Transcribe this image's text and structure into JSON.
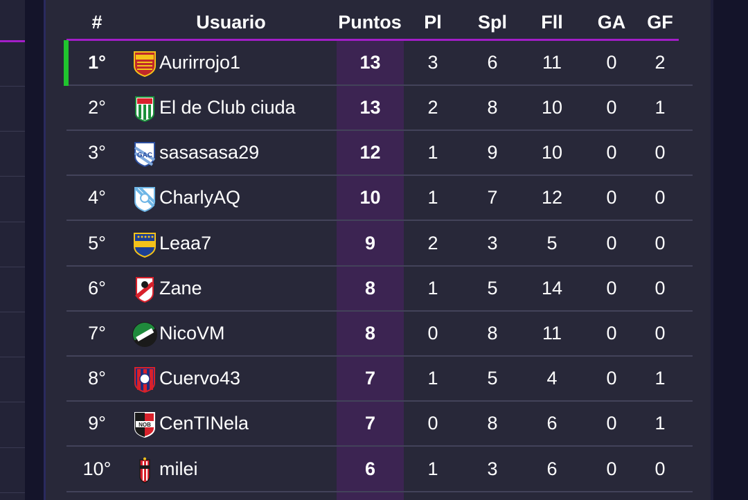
{
  "headers": {
    "pos": "#",
    "user": "Usuario",
    "points": "Puntos",
    "pl": "Pl",
    "spl": "Spl",
    "fll": "Fll",
    "ga": "GA",
    "gf": "GF"
  },
  "colors": {
    "accent": "#a31ec8",
    "leader": "#20c42e",
    "points_column": "#3c2452"
  },
  "rows": [
    {
      "pos": "1°",
      "user": "Aurirrojo1",
      "points": "13",
      "pl": "3",
      "spl": "6",
      "fll": "11",
      "ga": "0",
      "gf": "2",
      "crest": "boca-unidos-crest"
    },
    {
      "pos": "2°",
      "user": "El de Club ciuda",
      "points": "13",
      "pl": "2",
      "spl": "8",
      "fll": "10",
      "ga": "0",
      "gf": "1",
      "crest": "caa-crest"
    },
    {
      "pos": "3°",
      "user": "sasasasa29",
      "points": "12",
      "pl": "1",
      "spl": "9",
      "fll": "10",
      "ga": "0",
      "gf": "0",
      "crest": "gac-crest"
    },
    {
      "pos": "4°",
      "user": "CharlyAQ",
      "points": "10",
      "pl": "1",
      "spl": "7",
      "fll": "12",
      "ga": "0",
      "gf": "0",
      "crest": "ao-crest"
    },
    {
      "pos": "5°",
      "user": "Leaa7",
      "points": "9",
      "pl": "2",
      "spl": "3",
      "fll": "5",
      "ga": "0",
      "gf": "0",
      "crest": "cabj-crest"
    },
    {
      "pos": "6°",
      "user": "Zane",
      "points": "8",
      "pl": "1",
      "spl": "5",
      "fll": "14",
      "ga": "0",
      "gf": "0",
      "crest": "river-crest"
    },
    {
      "pos": "7°",
      "user": "NicoVM",
      "points": "8",
      "pl": "0",
      "spl": "8",
      "fll": "11",
      "ga": "0",
      "gf": "0",
      "crest": "cvm-crest"
    },
    {
      "pos": "8°",
      "user": "Cuervo43",
      "points": "7",
      "pl": "1",
      "spl": "5",
      "fll": "4",
      "ga": "0",
      "gf": "1",
      "crest": "casla-crest"
    },
    {
      "pos": "9°",
      "user": "CenTINela",
      "points": "7",
      "pl": "0",
      "spl": "8",
      "fll": "6",
      "ga": "0",
      "gf": "1",
      "crest": "nob-crest"
    },
    {
      "pos": "10°",
      "user": "milei",
      "points": "6",
      "pl": "1",
      "spl": "3",
      "fll": "6",
      "ga": "0",
      "gf": "0",
      "crest": "chacarita-crest"
    }
  ]
}
